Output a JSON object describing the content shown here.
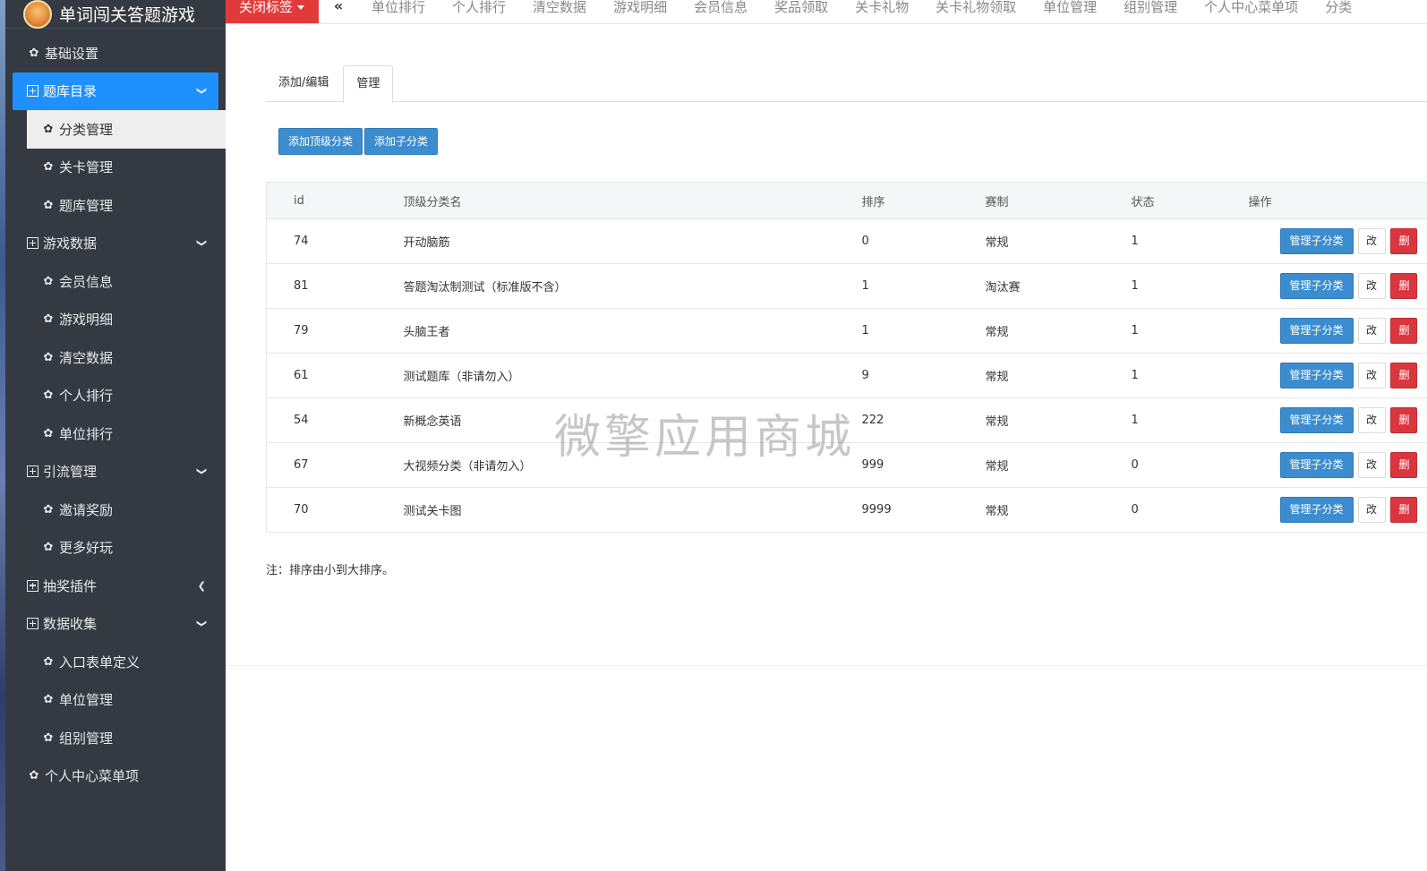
{
  "app": {
    "title": "单词闯关答题游戏"
  },
  "topnav": {
    "close_label": "关闭标签",
    "collapse_icon": "«",
    "tabs": [
      "单位排行",
      "个人排行",
      "清空数据",
      "游戏明细",
      "会员信息",
      "奖品领取",
      "关卡礼物",
      "关卡礼物领取",
      "单位管理",
      "组别管理",
      "个人中心菜单项",
      "分类"
    ]
  },
  "sidebar": {
    "items": [
      {
        "label": "基础设置",
        "level": 1,
        "icon": "gear-icon"
      },
      {
        "label": "题库目录",
        "level": 1,
        "icon": "plus-square-icon",
        "arrow": "chevron-down-icon"
      },
      {
        "label": "分类管理",
        "level": 2,
        "icon": "gear-icon"
      },
      {
        "label": "关卡管理",
        "level": 2,
        "icon": "gear-icon"
      },
      {
        "label": "题库管理",
        "level": 2,
        "icon": "gear-icon"
      },
      {
        "label": "游戏数据",
        "level": 1,
        "icon": "plus-square-icon",
        "arrow": "chevron-down-icon"
      },
      {
        "label": "会员信息",
        "level": 2,
        "icon": "gear-icon"
      },
      {
        "label": "游戏明细",
        "level": 2,
        "icon": "gear-icon"
      },
      {
        "label": "清空数据",
        "level": 2,
        "icon": "gear-icon"
      },
      {
        "label": "个人排行",
        "level": 2,
        "icon": "gear-icon"
      },
      {
        "label": "单位排行",
        "level": 2,
        "icon": "gear-icon"
      },
      {
        "label": "引流管理",
        "level": 1,
        "icon": "plus-square-icon",
        "arrow": "chevron-down-icon"
      },
      {
        "label": "邀请奖励",
        "level": 2,
        "icon": "gear-icon"
      },
      {
        "label": "更多好玩",
        "level": 2,
        "icon": "gear-icon"
      },
      {
        "label": "抽奖插件",
        "level": 1,
        "icon": "plus-square-icon",
        "arrow": "chevron-left-icon"
      },
      {
        "label": "数据收集",
        "level": 1,
        "icon": "plus-square-icon",
        "arrow": "chevron-down-icon"
      },
      {
        "label": "入口表单定义",
        "level": 2,
        "icon": "gear-icon"
      },
      {
        "label": "单位管理",
        "level": 2,
        "icon": "gear-icon"
      },
      {
        "label": "组别管理",
        "level": 2,
        "icon": "gear-icon"
      },
      {
        "label": "个人中心菜单项",
        "level": 1,
        "icon": "gear-icon"
      }
    ]
  },
  "content": {
    "tabs": [
      "添加/编辑",
      "管理"
    ],
    "buttons": {
      "add_top": "添加顶级分类",
      "add_child": "添加子分类"
    },
    "table": {
      "headers": [
        "id",
        "顶级分类名",
        "排序",
        "赛制",
        "状态",
        "操作"
      ],
      "rows": [
        [
          "74",
          "开动脑筋",
          "0",
          "常规",
          "1"
        ],
        [
          "81",
          "答题淘汰制测试（标准版不含）",
          "1",
          "淘汰赛",
          "1"
        ],
        [
          "79",
          "头脑王者",
          "1",
          "常规",
          "1"
        ],
        [
          "61",
          "测试题库（非请勿入）",
          "9",
          "常规",
          "1"
        ],
        [
          "54",
          "新概念英语",
          "222",
          "常规",
          "1"
        ],
        [
          "67",
          "大视频分类（非请勿入）",
          "999",
          "常规",
          "0"
        ],
        [
          "70",
          "测试关卡图",
          "9999",
          "常规",
          "0"
        ]
      ],
      "actions": {
        "manage": "管理子分类",
        "edit": "改",
        "delete": "删"
      }
    },
    "note": "注：排序由小到大排序。"
  },
  "watermark": "微擎应用商城",
  "colors": {
    "sidebar_bg": "#353a42",
    "accent": "#1e90ff",
    "primary_btn": "#3c8dcf",
    "danger": "#d9363e",
    "close_tab": "#e23a3a"
  }
}
